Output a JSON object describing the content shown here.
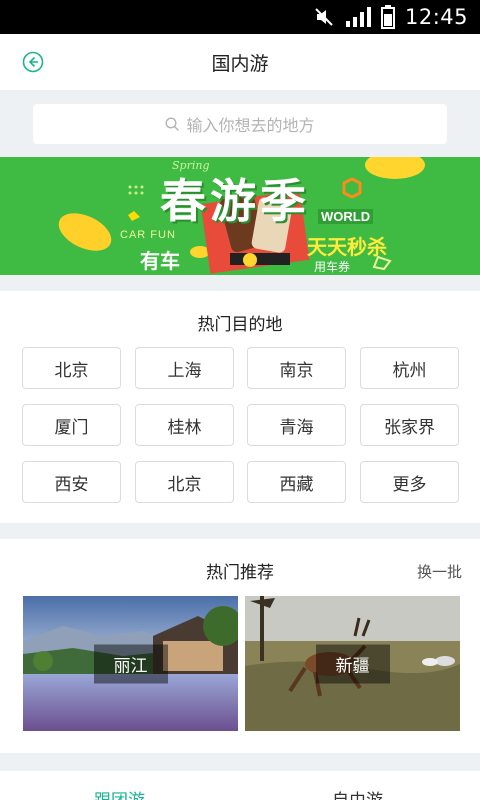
{
  "status_bar": {
    "time": "12:45"
  },
  "header": {
    "title": "国内游",
    "back_icon": "back-arrow-icon",
    "accent": "#19b394"
  },
  "search": {
    "placeholder": "输入你想去的地方",
    "icon": "search-icon"
  },
  "banner": {
    "title": "春游季",
    "tag_spring": "Spring",
    "tag_world": "WORLD",
    "slogan_left": "CAR FUN",
    "slogan_left_cn": "有车",
    "slogan_right": "天天秒杀",
    "slogan_right_sub": "用车券",
    "bg_color": "#3fba43"
  },
  "destinations": {
    "title": "热门目的地",
    "items": [
      "北京",
      "上海",
      "南京",
      "杭州",
      "厦门",
      "桂林",
      "青海",
      "张家界",
      "西安",
      "北京",
      "西藏",
      "更多"
    ]
  },
  "recommend": {
    "title": "热门推荐",
    "refresh": "换一批",
    "cards": [
      {
        "label": "丽江"
      },
      {
        "label": "新疆"
      }
    ]
  },
  "tabs": [
    {
      "label": "跟团游"
    },
    {
      "label": "自由游"
    }
  ]
}
